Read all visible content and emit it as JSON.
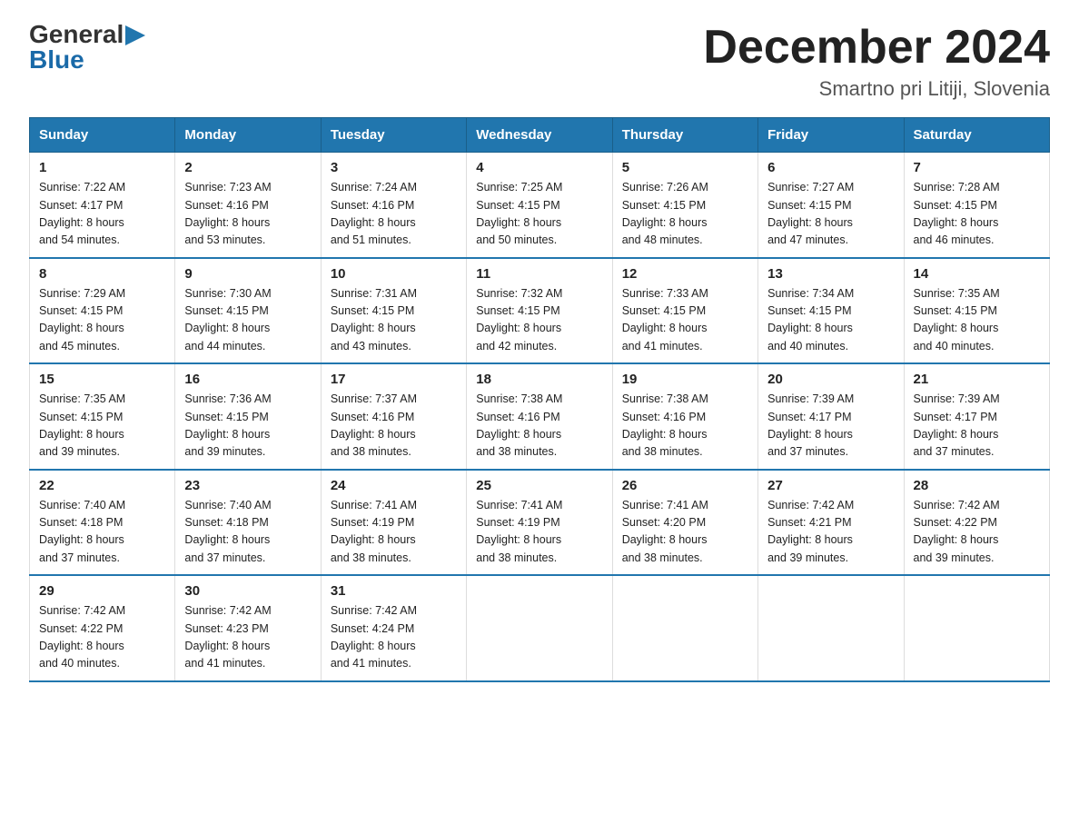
{
  "logo": {
    "general": "General",
    "blue": "Blue"
  },
  "title": "December 2024",
  "location": "Smartno pri Litiji, Slovenia",
  "days_header": [
    "Sunday",
    "Monday",
    "Tuesday",
    "Wednesday",
    "Thursday",
    "Friday",
    "Saturday"
  ],
  "weeks": [
    [
      {
        "day": "1",
        "sunrise": "7:22 AM",
        "sunset": "4:17 PM",
        "daylight": "8 hours and 54 minutes."
      },
      {
        "day": "2",
        "sunrise": "7:23 AM",
        "sunset": "4:16 PM",
        "daylight": "8 hours and 53 minutes."
      },
      {
        "day": "3",
        "sunrise": "7:24 AM",
        "sunset": "4:16 PM",
        "daylight": "8 hours and 51 minutes."
      },
      {
        "day": "4",
        "sunrise": "7:25 AM",
        "sunset": "4:15 PM",
        "daylight": "8 hours and 50 minutes."
      },
      {
        "day": "5",
        "sunrise": "7:26 AM",
        "sunset": "4:15 PM",
        "daylight": "8 hours and 48 minutes."
      },
      {
        "day": "6",
        "sunrise": "7:27 AM",
        "sunset": "4:15 PM",
        "daylight": "8 hours and 47 minutes."
      },
      {
        "day": "7",
        "sunrise": "7:28 AM",
        "sunset": "4:15 PM",
        "daylight": "8 hours and 46 minutes."
      }
    ],
    [
      {
        "day": "8",
        "sunrise": "7:29 AM",
        "sunset": "4:15 PM",
        "daylight": "8 hours and 45 minutes."
      },
      {
        "day": "9",
        "sunrise": "7:30 AM",
        "sunset": "4:15 PM",
        "daylight": "8 hours and 44 minutes."
      },
      {
        "day": "10",
        "sunrise": "7:31 AM",
        "sunset": "4:15 PM",
        "daylight": "8 hours and 43 minutes."
      },
      {
        "day": "11",
        "sunrise": "7:32 AM",
        "sunset": "4:15 PM",
        "daylight": "8 hours and 42 minutes."
      },
      {
        "day": "12",
        "sunrise": "7:33 AM",
        "sunset": "4:15 PM",
        "daylight": "8 hours and 41 minutes."
      },
      {
        "day": "13",
        "sunrise": "7:34 AM",
        "sunset": "4:15 PM",
        "daylight": "8 hours and 40 minutes."
      },
      {
        "day": "14",
        "sunrise": "7:35 AM",
        "sunset": "4:15 PM",
        "daylight": "8 hours and 40 minutes."
      }
    ],
    [
      {
        "day": "15",
        "sunrise": "7:35 AM",
        "sunset": "4:15 PM",
        "daylight": "8 hours and 39 minutes."
      },
      {
        "day": "16",
        "sunrise": "7:36 AM",
        "sunset": "4:15 PM",
        "daylight": "8 hours and 39 minutes."
      },
      {
        "day": "17",
        "sunrise": "7:37 AM",
        "sunset": "4:16 PM",
        "daylight": "8 hours and 38 minutes."
      },
      {
        "day": "18",
        "sunrise": "7:38 AM",
        "sunset": "4:16 PM",
        "daylight": "8 hours and 38 minutes."
      },
      {
        "day": "19",
        "sunrise": "7:38 AM",
        "sunset": "4:16 PM",
        "daylight": "8 hours and 38 minutes."
      },
      {
        "day": "20",
        "sunrise": "7:39 AM",
        "sunset": "4:17 PM",
        "daylight": "8 hours and 37 minutes."
      },
      {
        "day": "21",
        "sunrise": "7:39 AM",
        "sunset": "4:17 PM",
        "daylight": "8 hours and 37 minutes."
      }
    ],
    [
      {
        "day": "22",
        "sunrise": "7:40 AM",
        "sunset": "4:18 PM",
        "daylight": "8 hours and 37 minutes."
      },
      {
        "day": "23",
        "sunrise": "7:40 AM",
        "sunset": "4:18 PM",
        "daylight": "8 hours and 37 minutes."
      },
      {
        "day": "24",
        "sunrise": "7:41 AM",
        "sunset": "4:19 PM",
        "daylight": "8 hours and 38 minutes."
      },
      {
        "day": "25",
        "sunrise": "7:41 AM",
        "sunset": "4:19 PM",
        "daylight": "8 hours and 38 minutes."
      },
      {
        "day": "26",
        "sunrise": "7:41 AM",
        "sunset": "4:20 PM",
        "daylight": "8 hours and 38 minutes."
      },
      {
        "day": "27",
        "sunrise": "7:42 AM",
        "sunset": "4:21 PM",
        "daylight": "8 hours and 39 minutes."
      },
      {
        "day": "28",
        "sunrise": "7:42 AM",
        "sunset": "4:22 PM",
        "daylight": "8 hours and 39 minutes."
      }
    ],
    [
      {
        "day": "29",
        "sunrise": "7:42 AM",
        "sunset": "4:22 PM",
        "daylight": "8 hours and 40 minutes."
      },
      {
        "day": "30",
        "sunrise": "7:42 AM",
        "sunset": "4:23 PM",
        "daylight": "8 hours and 41 minutes."
      },
      {
        "day": "31",
        "sunrise": "7:42 AM",
        "sunset": "4:24 PM",
        "daylight": "8 hours and 41 minutes."
      },
      null,
      null,
      null,
      null
    ]
  ],
  "labels": {
    "sunrise": "Sunrise:",
    "sunset": "Sunset:",
    "daylight": "Daylight:"
  }
}
